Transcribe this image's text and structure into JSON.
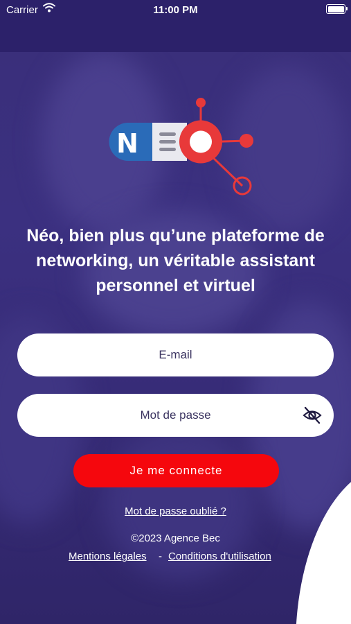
{
  "status": {
    "carrier": "Carrier",
    "time": "11:00 PM"
  },
  "tagline": "Néo, bien plus qu’une plateforme de networking, un véritable assistant personnel et virtuel",
  "form": {
    "email_placeholder": "E-mail",
    "password_placeholder": "Mot de passe",
    "login_label": "Je me connecte",
    "forgot_label": "Mot de passe oublié ?"
  },
  "footer": {
    "copyright": "©2023 Agence Bec",
    "legal_label": "Mentions légales",
    "separator": "-",
    "terms_label": "Conditions d'utilisation"
  },
  "colors": {
    "background": "#2f2869",
    "button": "#f5070d",
    "logo_blue": "#2a6bb8",
    "logo_red": "#e8393a"
  },
  "icons": [
    "wifi-icon",
    "battery-icon",
    "neo-logo",
    "eye-slash-icon"
  ]
}
